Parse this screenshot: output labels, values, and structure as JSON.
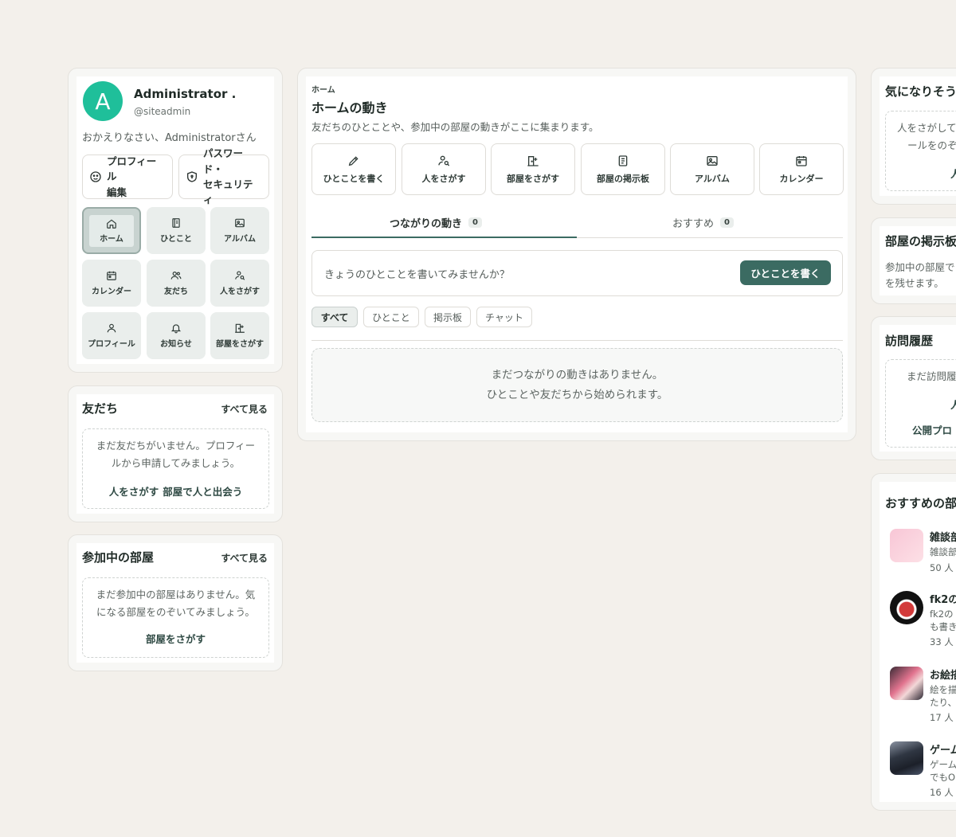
{
  "profile": {
    "avatar_letter": "A",
    "name": "Administrator .",
    "handle": "@siteadmin",
    "welcome": "おかえりなさい、Administratorさん",
    "edit_profile_line1": "プロフィール",
    "edit_profile_line2": "編集",
    "password_line1": "パスワード・",
    "password_line2": "セキュリティ"
  },
  "nav_tiles": [
    {
      "label": "ホーム",
      "icon": "home-icon",
      "active": true
    },
    {
      "label": "ひとこと",
      "icon": "notebook-icon"
    },
    {
      "label": "アルバム",
      "icon": "image-icon"
    },
    {
      "label": "カレンダー",
      "icon": "calendar-icon"
    },
    {
      "label": "友だち",
      "icon": "users-icon"
    },
    {
      "label": "人をさがす",
      "icon": "user-search-icon"
    },
    {
      "label": "プロフィール",
      "icon": "user-icon"
    },
    {
      "label": "お知らせ",
      "icon": "bell-icon"
    },
    {
      "label": "部屋をさがす",
      "icon": "door-icon"
    }
  ],
  "friends": {
    "title": "友だち",
    "see_all": "すべて見る",
    "empty_line1": "まだ友だちがいません。プロフィー",
    "empty_line2": "ルから申請してみましょう。",
    "link1": "人をさがす",
    "link2": "部屋で人と出会う"
  },
  "rooms_joined": {
    "title": "参加中の部屋",
    "see_all": "すべて見る",
    "empty_line1": "まだ参加中の部屋はありません。気",
    "empty_line2": "になる部屋をのぞいてみましょう。",
    "link": "部屋をさがす"
  },
  "main": {
    "breadcrumb": "ホーム",
    "title": "ホームの動き",
    "subtitle": "友だちのひとことや、参加中の部屋の動きがここに集まります。",
    "quick_actions": [
      {
        "label": "ひとことを書く",
        "icon": "pencil-icon"
      },
      {
        "label": "人をさがす",
        "icon": "user-search-icon"
      },
      {
        "label": "部屋をさがす",
        "icon": "door-icon"
      },
      {
        "label": "部屋の掲示板",
        "icon": "board-icon"
      },
      {
        "label": "アルバム",
        "icon": "image-icon"
      },
      {
        "label": "カレンダー",
        "icon": "calendar-icon"
      }
    ],
    "tabs": [
      {
        "label": "つながりの動き",
        "count": "0",
        "active": true
      },
      {
        "label": "おすすめ",
        "count": "0"
      }
    ],
    "composer_prompt": "きょうのひとことを書いてみませんか？",
    "composer_button": "ひとことを書く",
    "filters": [
      "すべて",
      "ひとこと",
      "掲示板",
      "チャット"
    ],
    "empty_line1": "まだつながりの動きはありません。",
    "empty_line2": "ひとことや友だちから始められます。"
  },
  "right": {
    "interest": {
      "title": "気になりそう",
      "line1": "人をさがして",
      "line2": "ールをのぞ",
      "link": "人"
    },
    "board": {
      "title": "部屋の掲示板",
      "line1": "参加中の部屋で",
      "line2": "を残せます。"
    },
    "history": {
      "title": "訪問履歴",
      "line1": "まだ訪問履",
      "link1": "人",
      "link2": "公開プロ"
    },
    "recommended": {
      "title": "おすすめの部",
      "rooms": [
        {
          "name": "雑談部",
          "desc1": "雑談部",
          "desc2": "",
          "count": "50 人"
        },
        {
          "name": "fk2の",
          "desc1": "fk2の",
          "desc2": "も書き",
          "count": "33 人"
        },
        {
          "name": "お絵描",
          "desc1": "絵を描",
          "desc2": "たり、",
          "count": "17 人"
        },
        {
          "name": "ゲーム",
          "desc1": "ゲーム",
          "desc2": "でもO",
          "count": "16 人"
        }
      ]
    }
  },
  "colors": {
    "background": "#f3f0eb",
    "accent": "#3b6b62",
    "avatar": "#1fbf9a"
  }
}
